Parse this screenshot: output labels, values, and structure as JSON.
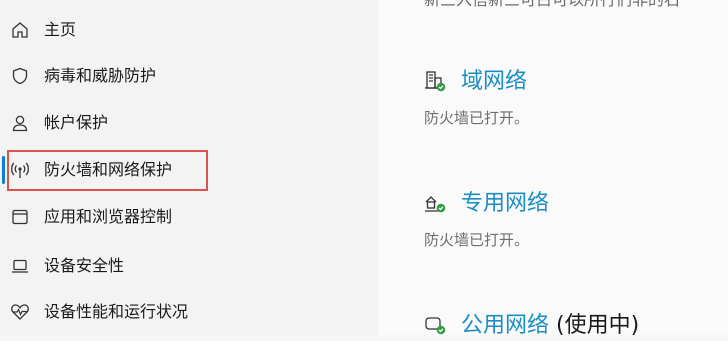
{
  "sidebar": {
    "items": [
      {
        "label": "主页",
        "icon": "home-icon"
      },
      {
        "label": "病毒和威胁防护",
        "icon": "shield-icon"
      },
      {
        "label": "帐户保护",
        "icon": "person-icon"
      },
      {
        "label": "防火墙和网络保护",
        "icon": "antenna-icon"
      },
      {
        "label": "应用和浏览器控制",
        "icon": "browser-window-icon"
      },
      {
        "label": "设备安全性",
        "icon": "laptop-icon"
      },
      {
        "label": "设备性能和运行状况",
        "icon": "heart-pulse-icon"
      }
    ],
    "active_index": 3
  },
  "main": {
    "top_text": "新三入信新三可占可以所行们非的石",
    "networks": [
      {
        "title": "域网络",
        "suffix": "",
        "status": "防火墙已打开。",
        "icon": "domain-network-icon"
      },
      {
        "title": "专用网络",
        "suffix": "",
        "status": "防火墙已打开。",
        "icon": "private-network-icon"
      },
      {
        "title": "公用网络",
        "suffix": " (使用中)",
        "status": "",
        "icon": "public-network-icon"
      }
    ]
  },
  "colors": {
    "accent": "#0a7fd6",
    "link": "#1a8ec2",
    "highlight": "#d9534f",
    "ok_badge": "#2f9e44"
  }
}
